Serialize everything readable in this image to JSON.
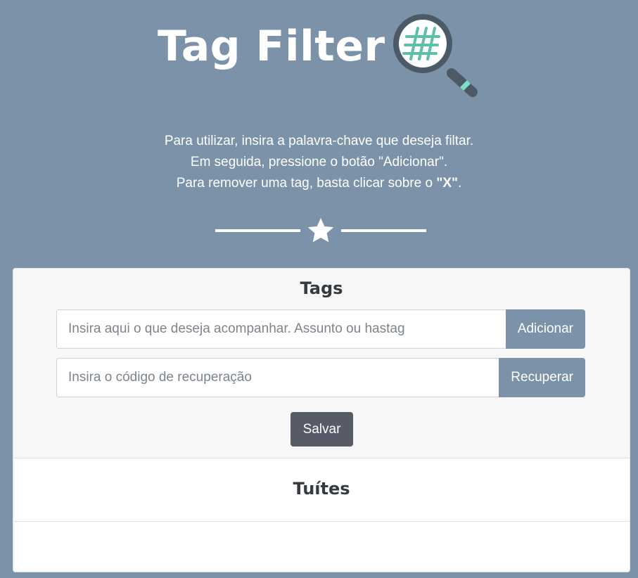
{
  "header": {
    "title": "Tag Filter",
    "logo_icon": "magnifier-hashtag-icon",
    "colors": {
      "background": "#7b92a8",
      "logo_ring": "#4c5a67",
      "logo_hashtag": "#5fbfa8"
    }
  },
  "instructions": {
    "line1": "Para utilizar, insira a palavra-chave que deseja filtar.",
    "line2": "Em seguida, pressione o botão \"Adicionar\".",
    "line3_prefix": "Para remover uma tag, basta clicar sobre o ",
    "line3_emphasis": "\"X\"",
    "line3_suffix": "."
  },
  "divider": {
    "icon": "star-icon"
  },
  "tags_section": {
    "title": "Tags",
    "tag_input": {
      "value": "",
      "placeholder": "Insira aqui o que deseja acompanhar. Assunto ou hastag"
    },
    "add_button": "Adicionar",
    "recovery_input": {
      "value": "",
      "placeholder": "Insira o código de recuperação"
    },
    "recover_button": "Recuperar",
    "save_button": "Salvar"
  },
  "tweets_section": {
    "title": "Tuítes",
    "items": []
  }
}
